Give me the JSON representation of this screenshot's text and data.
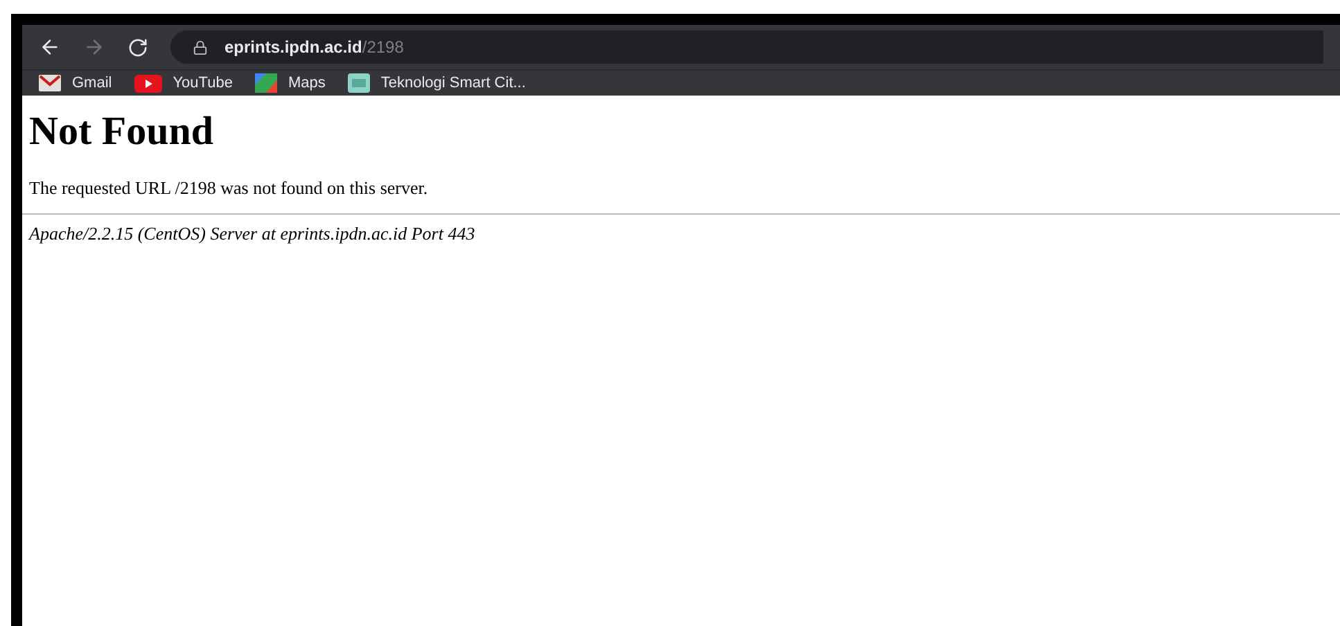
{
  "address_bar": {
    "host": "eprints.ipdn.ac.id",
    "path": "/2198"
  },
  "bookmarks": [
    {
      "label": "Gmail",
      "kind": "mail"
    },
    {
      "label": "YouTube",
      "kind": "video"
    },
    {
      "label": "Maps",
      "kind": "map"
    },
    {
      "label": "Teknologi Smart Cit...",
      "kind": "site"
    }
  ],
  "page": {
    "heading": "Not Found",
    "message": "The requested URL /2198 was not found on this server.",
    "footer": "Apache/2.2.15 (CentOS) Server at eprints.ipdn.ac.id Port 443"
  }
}
